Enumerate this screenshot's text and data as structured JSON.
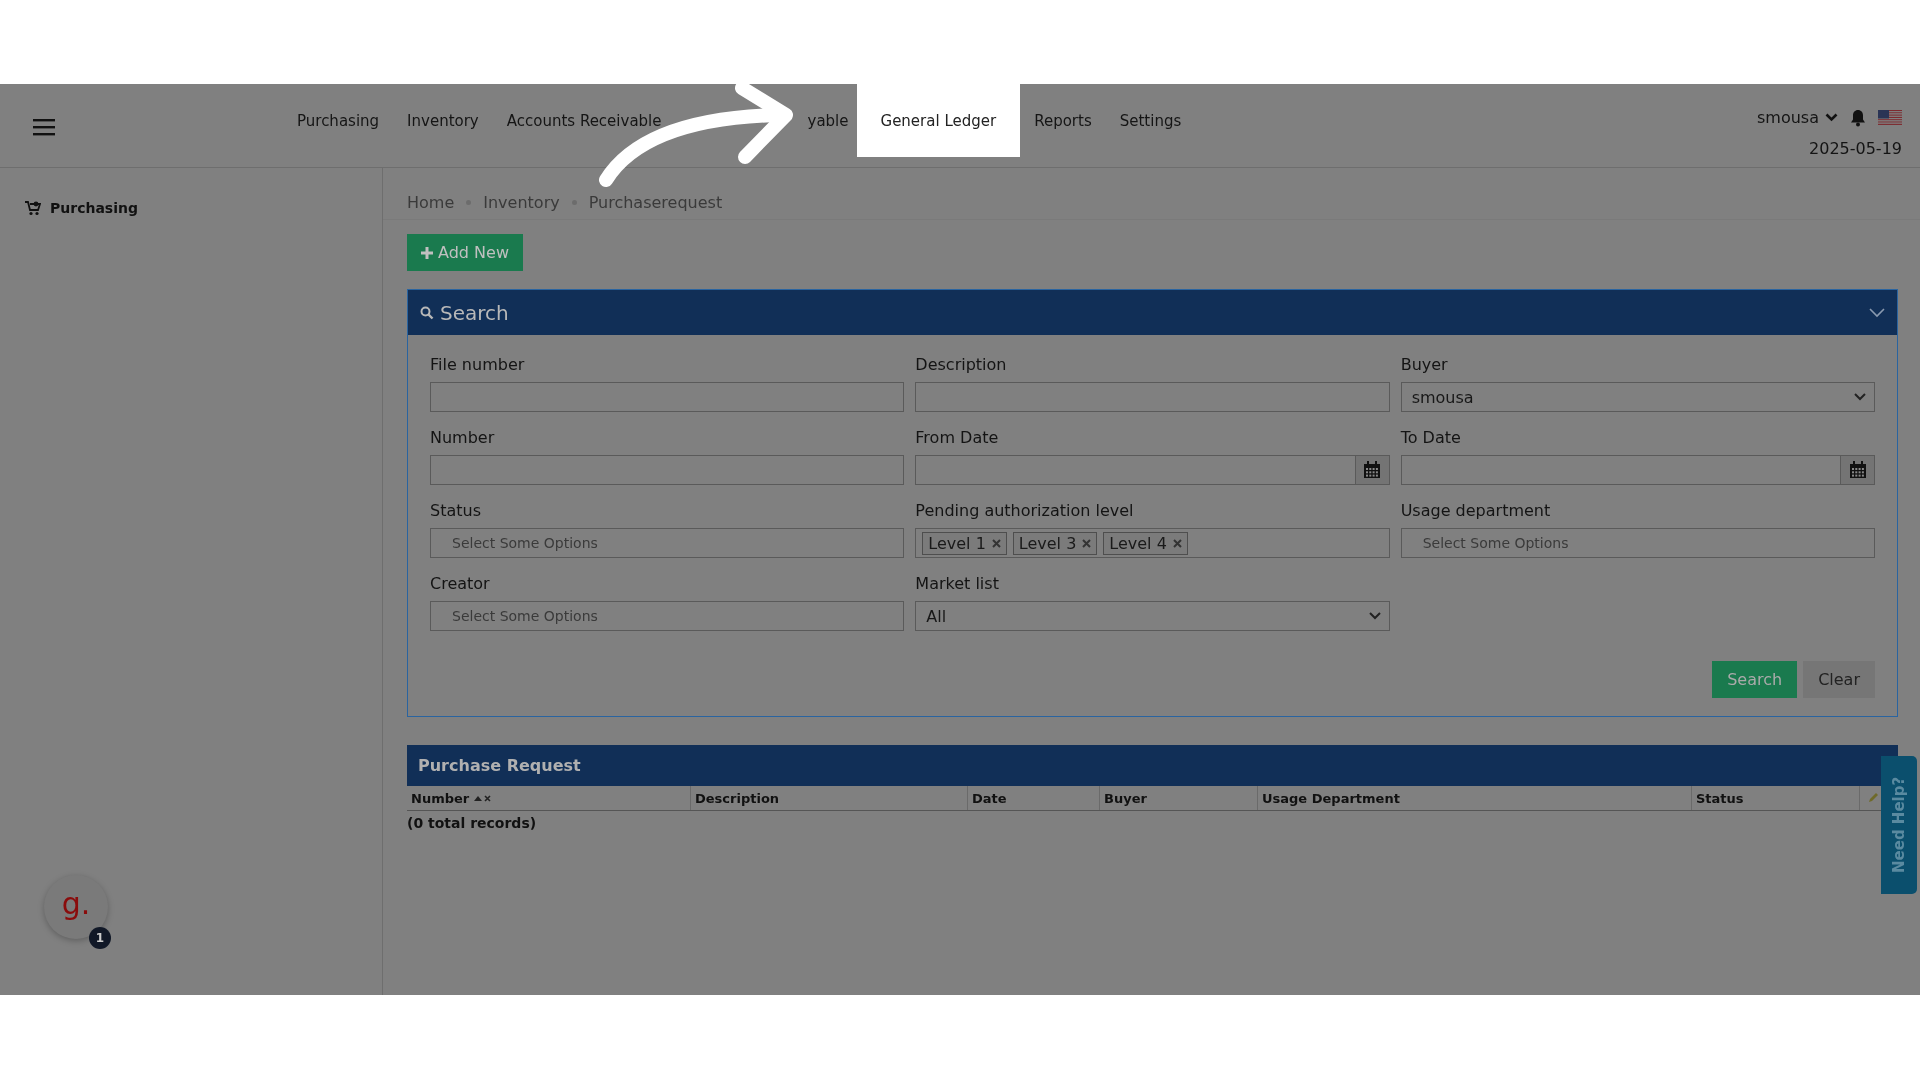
{
  "nav": {
    "items": [
      {
        "label": "Purchasing",
        "selected": false
      },
      {
        "label": "Inventory",
        "selected": false
      },
      {
        "label": "Accounts Receivable",
        "selected": false
      },
      {
        "label": "yable",
        "selected": false
      },
      {
        "label": "General Ledger",
        "selected": true
      },
      {
        "label": "Reports",
        "selected": false
      },
      {
        "label": "Settings",
        "selected": false
      }
    ],
    "user": "smousa",
    "date": "2025-05-19"
  },
  "sidebar": {
    "items": [
      {
        "label": "Purchasing"
      }
    ]
  },
  "breadcrumb": [
    "Home",
    "Inventory",
    "Purchaserequest"
  ],
  "add_button": "Add New",
  "search_panel": {
    "title": "Search",
    "fields": [
      {
        "label": "File number",
        "kind": "text"
      },
      {
        "label": "Description",
        "kind": "text"
      },
      {
        "label": "Buyer",
        "kind": "select",
        "value": "smousa"
      },
      {
        "label": "Number",
        "kind": "text"
      },
      {
        "label": "From Date",
        "kind": "date"
      },
      {
        "label": "To Date",
        "kind": "date"
      },
      {
        "label": "Status",
        "kind": "multiselect",
        "placeholder": "Select Some Options"
      },
      {
        "label": "Pending authorization level",
        "kind": "multiselect",
        "tags": [
          "Level 1",
          "Level 3",
          "Level 4"
        ]
      },
      {
        "label": "Usage department",
        "kind": "multiselect",
        "placeholder": "Select Some Options"
      },
      {
        "label": "Creator",
        "kind": "multiselect",
        "placeholder": "Select Some Options"
      },
      {
        "label": "Market list",
        "kind": "select",
        "value": "All"
      }
    ],
    "buttons": [
      {
        "label": "Search",
        "kind": "primary"
      },
      {
        "label": "Clear",
        "kind": "secondary"
      }
    ]
  },
  "table": {
    "title": "Purchase Request",
    "columns": [
      {
        "label": "Number",
        "sorted": true
      },
      {
        "label": "Description",
        "sorted": false
      },
      {
        "label": "Date",
        "sorted": false
      },
      {
        "label": "Buyer",
        "sorted": false
      },
      {
        "label": "Usage Department",
        "sorted": false
      },
      {
        "label": "Status",
        "sorted": false
      }
    ],
    "footer": "(0 total records)"
  },
  "help_tab": "Need Help?",
  "widget": {
    "letter": "g.",
    "badge": "1"
  }
}
